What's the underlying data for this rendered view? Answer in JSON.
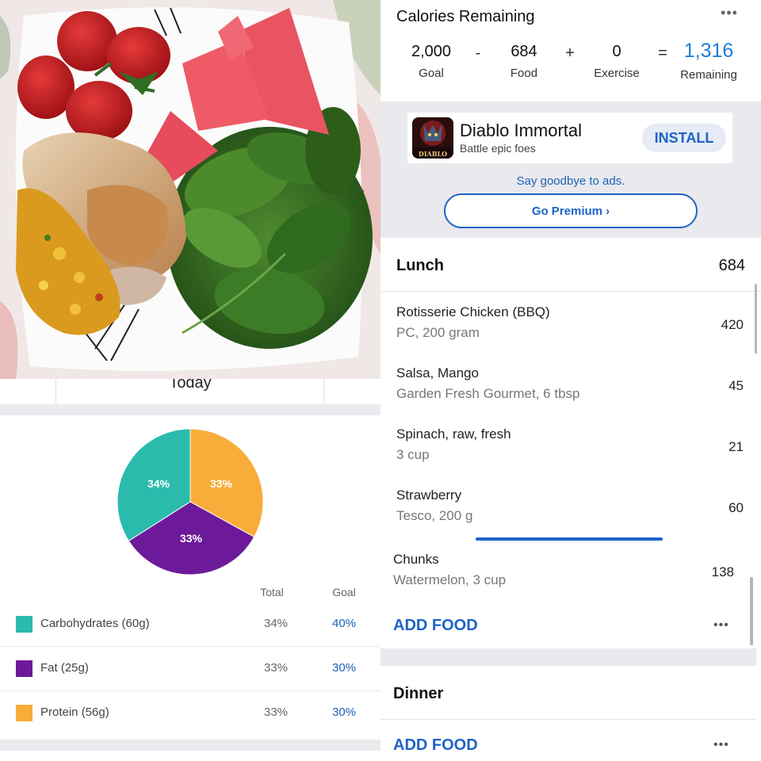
{
  "date": {
    "label": "Today"
  },
  "macros": {
    "pie_labels": [
      "34%",
      "33%",
      "33%"
    ],
    "header": {
      "total": "Total",
      "goal": "Goal"
    },
    "rows": [
      {
        "name": "Carbohydrates (60g)",
        "total": "34%",
        "goal": "40%",
        "color": "#2bbbad"
      },
      {
        "name": "Fat (25g)",
        "total": "33%",
        "goal": "30%",
        "color": "#6c1a9a"
      },
      {
        "name": "Protein (56g)",
        "total": "33%",
        "goal": "30%",
        "color": "#f9ac3a"
      }
    ]
  },
  "calories": {
    "title": "Calories Remaining",
    "more_icon": "more-horizontal-icon",
    "goal": {
      "value": "2,000",
      "label": "Goal"
    },
    "food": {
      "value": "684",
      "label": "Food"
    },
    "exercise": {
      "value": "0",
      "label": "Exercise"
    },
    "remaining": {
      "value": "1,316",
      "label": "Remaining"
    },
    "ops": [
      "-",
      "+",
      "="
    ]
  },
  "ad": {
    "title": "Diablo Immortal",
    "subtitle": "Battle epic foes",
    "icon_text": "DIABLO",
    "install": "INSTALL",
    "goodbye": "Say goodbye to ads.",
    "premium": "Go Premium ›"
  },
  "lunch": {
    "title": "Lunch",
    "calories": "684",
    "items": [
      {
        "name": "Rotisserie Chicken (BBQ)",
        "desc": "PC, 200 gram",
        "cal": "420"
      },
      {
        "name": "Salsa, Mango",
        "desc": "Garden Fresh Gourmet, 6 tbsp",
        "cal": "45"
      },
      {
        "name": "Spinach, raw, fresh",
        "desc": "3 cup",
        "cal": "21"
      },
      {
        "name": "Strawberry",
        "desc": "Tesco, 200 g",
        "cal": "60"
      },
      {
        "name": "Chunks",
        "desc": "Watermelon, 3 cup",
        "cal": "138"
      }
    ],
    "add_food": "ADD FOOD",
    "more": "•••"
  },
  "dinner": {
    "title": "Dinner",
    "add_food": "ADD FOOD",
    "more": "•••"
  },
  "colors": {
    "accent": "#1e63c8",
    "remaining": "#1e7ed6",
    "separator": "#e9e9ee"
  }
}
